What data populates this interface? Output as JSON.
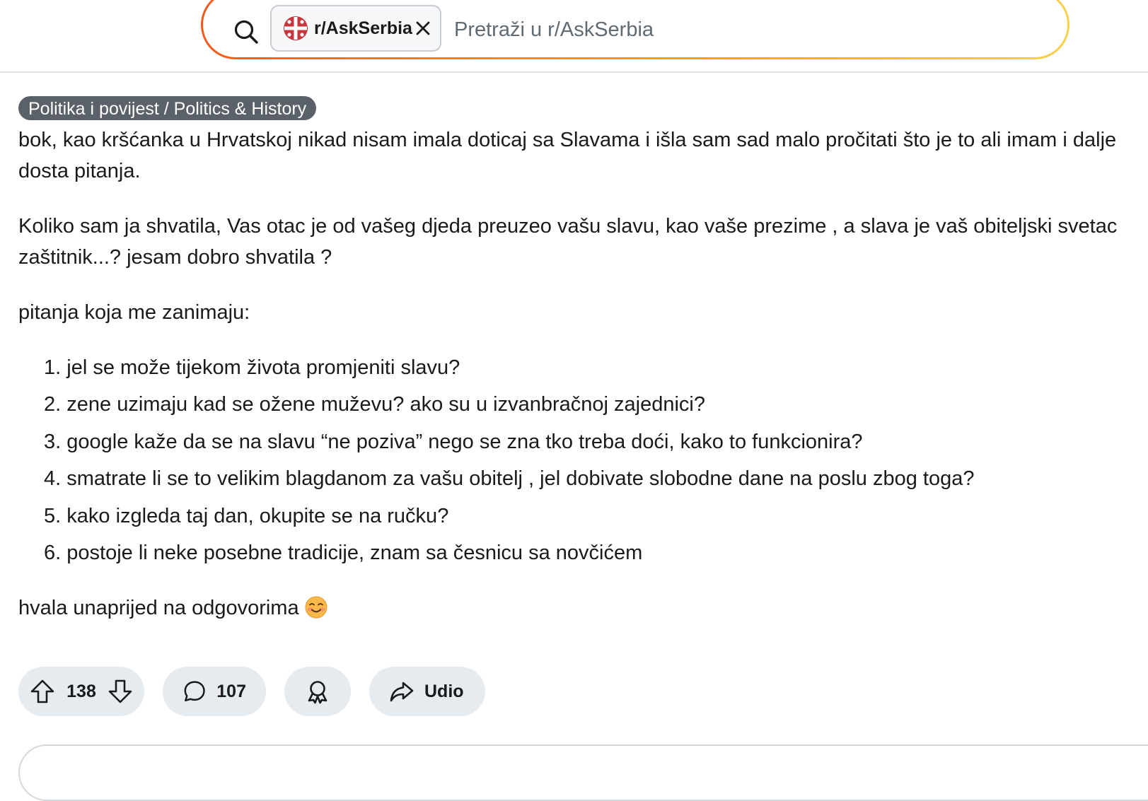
{
  "search": {
    "community_label": "r/AskSerbia",
    "placeholder": "Pretraži u r/AskSerbia",
    "value": ""
  },
  "post": {
    "flair": "Politika i povijest / Politics & History",
    "paragraph_1": "bok, kao kršćanka u Hrvatskoj nikad nisam imala doticaj sa Slavama i išla sam sad malo pročitati što je to ali imam i dalje dosta pitanja.",
    "paragraph_2": "Koliko sam ja shvatila, Vas otac je od vašeg djeda preuzeo vašu slavu, kao vaše prezime , a slava je vaš obiteljski svetac zaštitnik...? jesam dobro shvatila ?",
    "paragraph_3": "pitanja koja me zanimaju:",
    "questions": [
      {
        "num": "1.",
        "text": "jel se može tijekom života promjeniti slavu?"
      },
      {
        "num": "2.",
        "text": "zene uzimaju kad se ožene muževu? ako su u izvanbračnoj zajednici?"
      },
      {
        "num": "3.",
        "text": "google kaže da se na slavu “ne poziva” nego se zna tko treba doći, kako to funkcionira?"
      },
      {
        "num": "4.",
        "text": "smatrate li se to velikim blagdanom za vašu obitelj , jel dobivate slobodne dane na poslu zbog toga?"
      },
      {
        "num": "5.",
        "text": "kako izgleda taj dan, okupite se na ručku?"
      },
      {
        "num": "6.",
        "text": "postoje li neke posebne tradicije, znam sa česnicu sa novčićem"
      }
    ],
    "paragraph_4": "hvala unaprijed na odgovorima",
    "closing_emoji": "smiling-face-emoji"
  },
  "actions": {
    "vote_count": "138",
    "comment_count": "107",
    "share_label": "Udio"
  },
  "icons": {
    "search": "search-icon",
    "community_avatar": "serbian-cross-icon",
    "clear": "close-icon",
    "upvote": "arrow-up-icon",
    "downvote": "arrow-down-icon",
    "comment": "comment-bubble-icon",
    "award": "award-icon",
    "share": "share-arrow-icon"
  },
  "colors": {
    "flair_bg": "#5a6168",
    "pill_bg": "#e5ebee",
    "search_gradient_start": "#f25a1c",
    "search_gradient_end": "#f7d14b",
    "community_avatar_red": "#c6363c"
  }
}
